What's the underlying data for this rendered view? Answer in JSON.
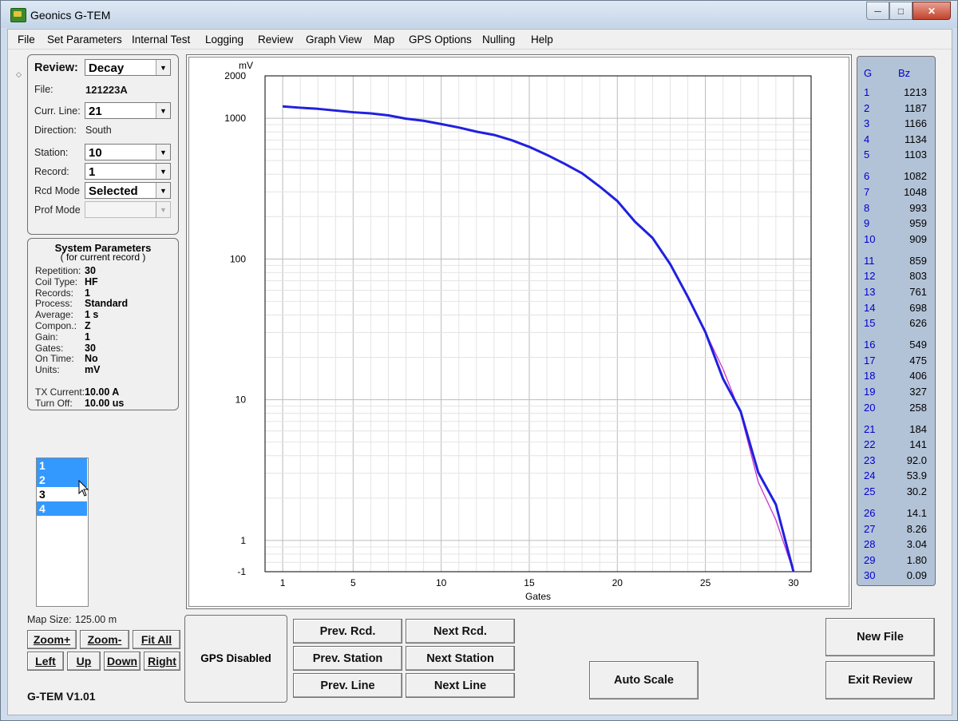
{
  "window": {
    "title": "Geonics G-TEM"
  },
  "menu": [
    "File",
    "Set Parameters",
    "Internal Test",
    "Logging",
    "Review",
    "Graph View",
    "Map",
    "GPS Options",
    "Nulling",
    "Help"
  ],
  "review": {
    "review_label": "Review:",
    "review_value": "Decay",
    "file_label": "File:",
    "file_value": "121223A",
    "curr_line_label": "Curr. Line:",
    "curr_line_value": "21",
    "direction_label": "Direction:",
    "direction_value": "South",
    "station_label": "Station:",
    "station_value": "10",
    "record_label": "Record:",
    "record_value": "1",
    "rcd_mode_label": "Rcd Mode",
    "rcd_mode_value": "Selected",
    "prof_mode_label": "Prof Mode",
    "prof_mode_value": ""
  },
  "system_params": {
    "title": "System Parameters",
    "subtitle": "( for current record )",
    "rows": [
      {
        "label": "Repetition:",
        "value": "30"
      },
      {
        "label": "Coil Type:",
        "value": "HF"
      },
      {
        "label": "Records:",
        "value": "1"
      },
      {
        "label": "Process:",
        "value": "Standard"
      },
      {
        "label": "Average:",
        "value": "1 s"
      },
      {
        "label": "Compon.:",
        "value": "Z"
      },
      {
        "label": "Gain:",
        "value": "1"
      },
      {
        "label": "Gates:",
        "value": "30"
      },
      {
        "label": "On Time:",
        "value": "No"
      },
      {
        "label": "Units:",
        "value": "mV"
      }
    ],
    "rows2": [
      {
        "label": "TX Current:",
        "value": "10.00 A"
      },
      {
        "label": "Turn Off:",
        "value": "10.00 us"
      }
    ]
  },
  "record_list": [
    {
      "label": "1",
      "selected": true
    },
    {
      "label": "2",
      "selected": true
    },
    {
      "label": "3",
      "selected": false
    },
    {
      "label": "4",
      "selected": true
    }
  ],
  "map": {
    "size_label": "Map Size:",
    "size_value": "125.00 m",
    "zoom_in": "Zoom+",
    "zoom_out": "Zoom-",
    "fit_all": "Fit All",
    "left": "Left",
    "up": "Up",
    "down": "Down",
    "right": "Right"
  },
  "version": "G-TEM V1.01",
  "gps_status": "GPS Disabled",
  "nav": {
    "prev_rcd": "Prev. Rcd.",
    "next_rcd": "Next Rcd.",
    "prev_station": "Prev. Station",
    "next_station": "Next Station",
    "prev_line": "Prev. Line",
    "next_line": "Next Line",
    "auto_scale": "Auto Scale",
    "new_file": "New File",
    "exit_review": "Exit Review"
  },
  "side": {
    "g_header": "G",
    "bz_header": "Bz",
    "rows": [
      {
        "g": "1",
        "bz": "1213"
      },
      {
        "g": "2",
        "bz": "1187"
      },
      {
        "g": "3",
        "bz": "1166"
      },
      {
        "g": "4",
        "bz": "1134"
      },
      {
        "g": "5",
        "bz": "1103"
      },
      {
        "g": "6",
        "bz": "1082"
      },
      {
        "g": "7",
        "bz": "1048"
      },
      {
        "g": "8",
        "bz": "993"
      },
      {
        "g": "9",
        "bz": "959"
      },
      {
        "g": "10",
        "bz": "909"
      },
      {
        "g": "11",
        "bz": "859"
      },
      {
        "g": "12",
        "bz": "803"
      },
      {
        "g": "13",
        "bz": "761"
      },
      {
        "g": "14",
        "bz": "698"
      },
      {
        "g": "15",
        "bz": "626"
      },
      {
        "g": "16",
        "bz": "549"
      },
      {
        "g": "17",
        "bz": "475"
      },
      {
        "g": "18",
        "bz": "406"
      },
      {
        "g": "19",
        "bz": "327"
      },
      {
        "g": "20",
        "bz": "258"
      },
      {
        "g": "21",
        "bz": "184"
      },
      {
        "g": "22",
        "bz": "141"
      },
      {
        "g": "23",
        "bz": "92.0"
      },
      {
        "g": "24",
        "bz": "53.9"
      },
      {
        "g": "25",
        "bz": "30.2"
      },
      {
        "g": "26",
        "bz": "14.1"
      },
      {
        "g": "27",
        "bz": "8.26"
      },
      {
        "g": "28",
        "bz": "3.04"
      },
      {
        "g": "29",
        "bz": "1.80"
      },
      {
        "g": "30",
        "bz": "0.09"
      }
    ]
  },
  "chart_data": {
    "type": "line",
    "title": "",
    "xlabel": "Gates",
    "ylabel": "mV",
    "y_scale": "log",
    "xlim": [
      0,
      31
    ],
    "ylim": [
      0.6,
      2000
    ],
    "x_ticks": [
      "1",
      "5",
      "10",
      "15",
      "20",
      "25",
      "30"
    ],
    "y_ticks": [
      "2000",
      "1000",
      "100",
      "10",
      "1",
      "-1"
    ],
    "grid": true,
    "legend": "none",
    "x": [
      1,
      2,
      3,
      4,
      5,
      6,
      7,
      8,
      9,
      10,
      11,
      12,
      13,
      14,
      15,
      16,
      17,
      18,
      19,
      20,
      21,
      22,
      23,
      24,
      25,
      26,
      27,
      28,
      29,
      30
    ],
    "series": [
      {
        "color": "#2020e0",
        "values": [
          1213,
          1187,
          1166,
          1134,
          1103,
          1082,
          1048,
          993,
          959,
          909,
          859,
          803,
          761,
          698,
          626,
          549,
          475,
          406,
          327,
          258,
          184,
          141,
          92.0,
          53.9,
          30.2,
          14.1,
          8.26,
          3.04,
          1.8,
          0.09
        ]
      },
      {
        "color": "#cc33cc",
        "values": [
          1213,
          1187,
          1166,
          1134,
          1103,
          1082,
          1048,
          993,
          959,
          909,
          859,
          803,
          761,
          698,
          626,
          549,
          475,
          406,
          327,
          258,
          184,
          141,
          92.0,
          53.9,
          30.2,
          16.5,
          8.0,
          2.6,
          1.4,
          0.09
        ]
      }
    ]
  }
}
